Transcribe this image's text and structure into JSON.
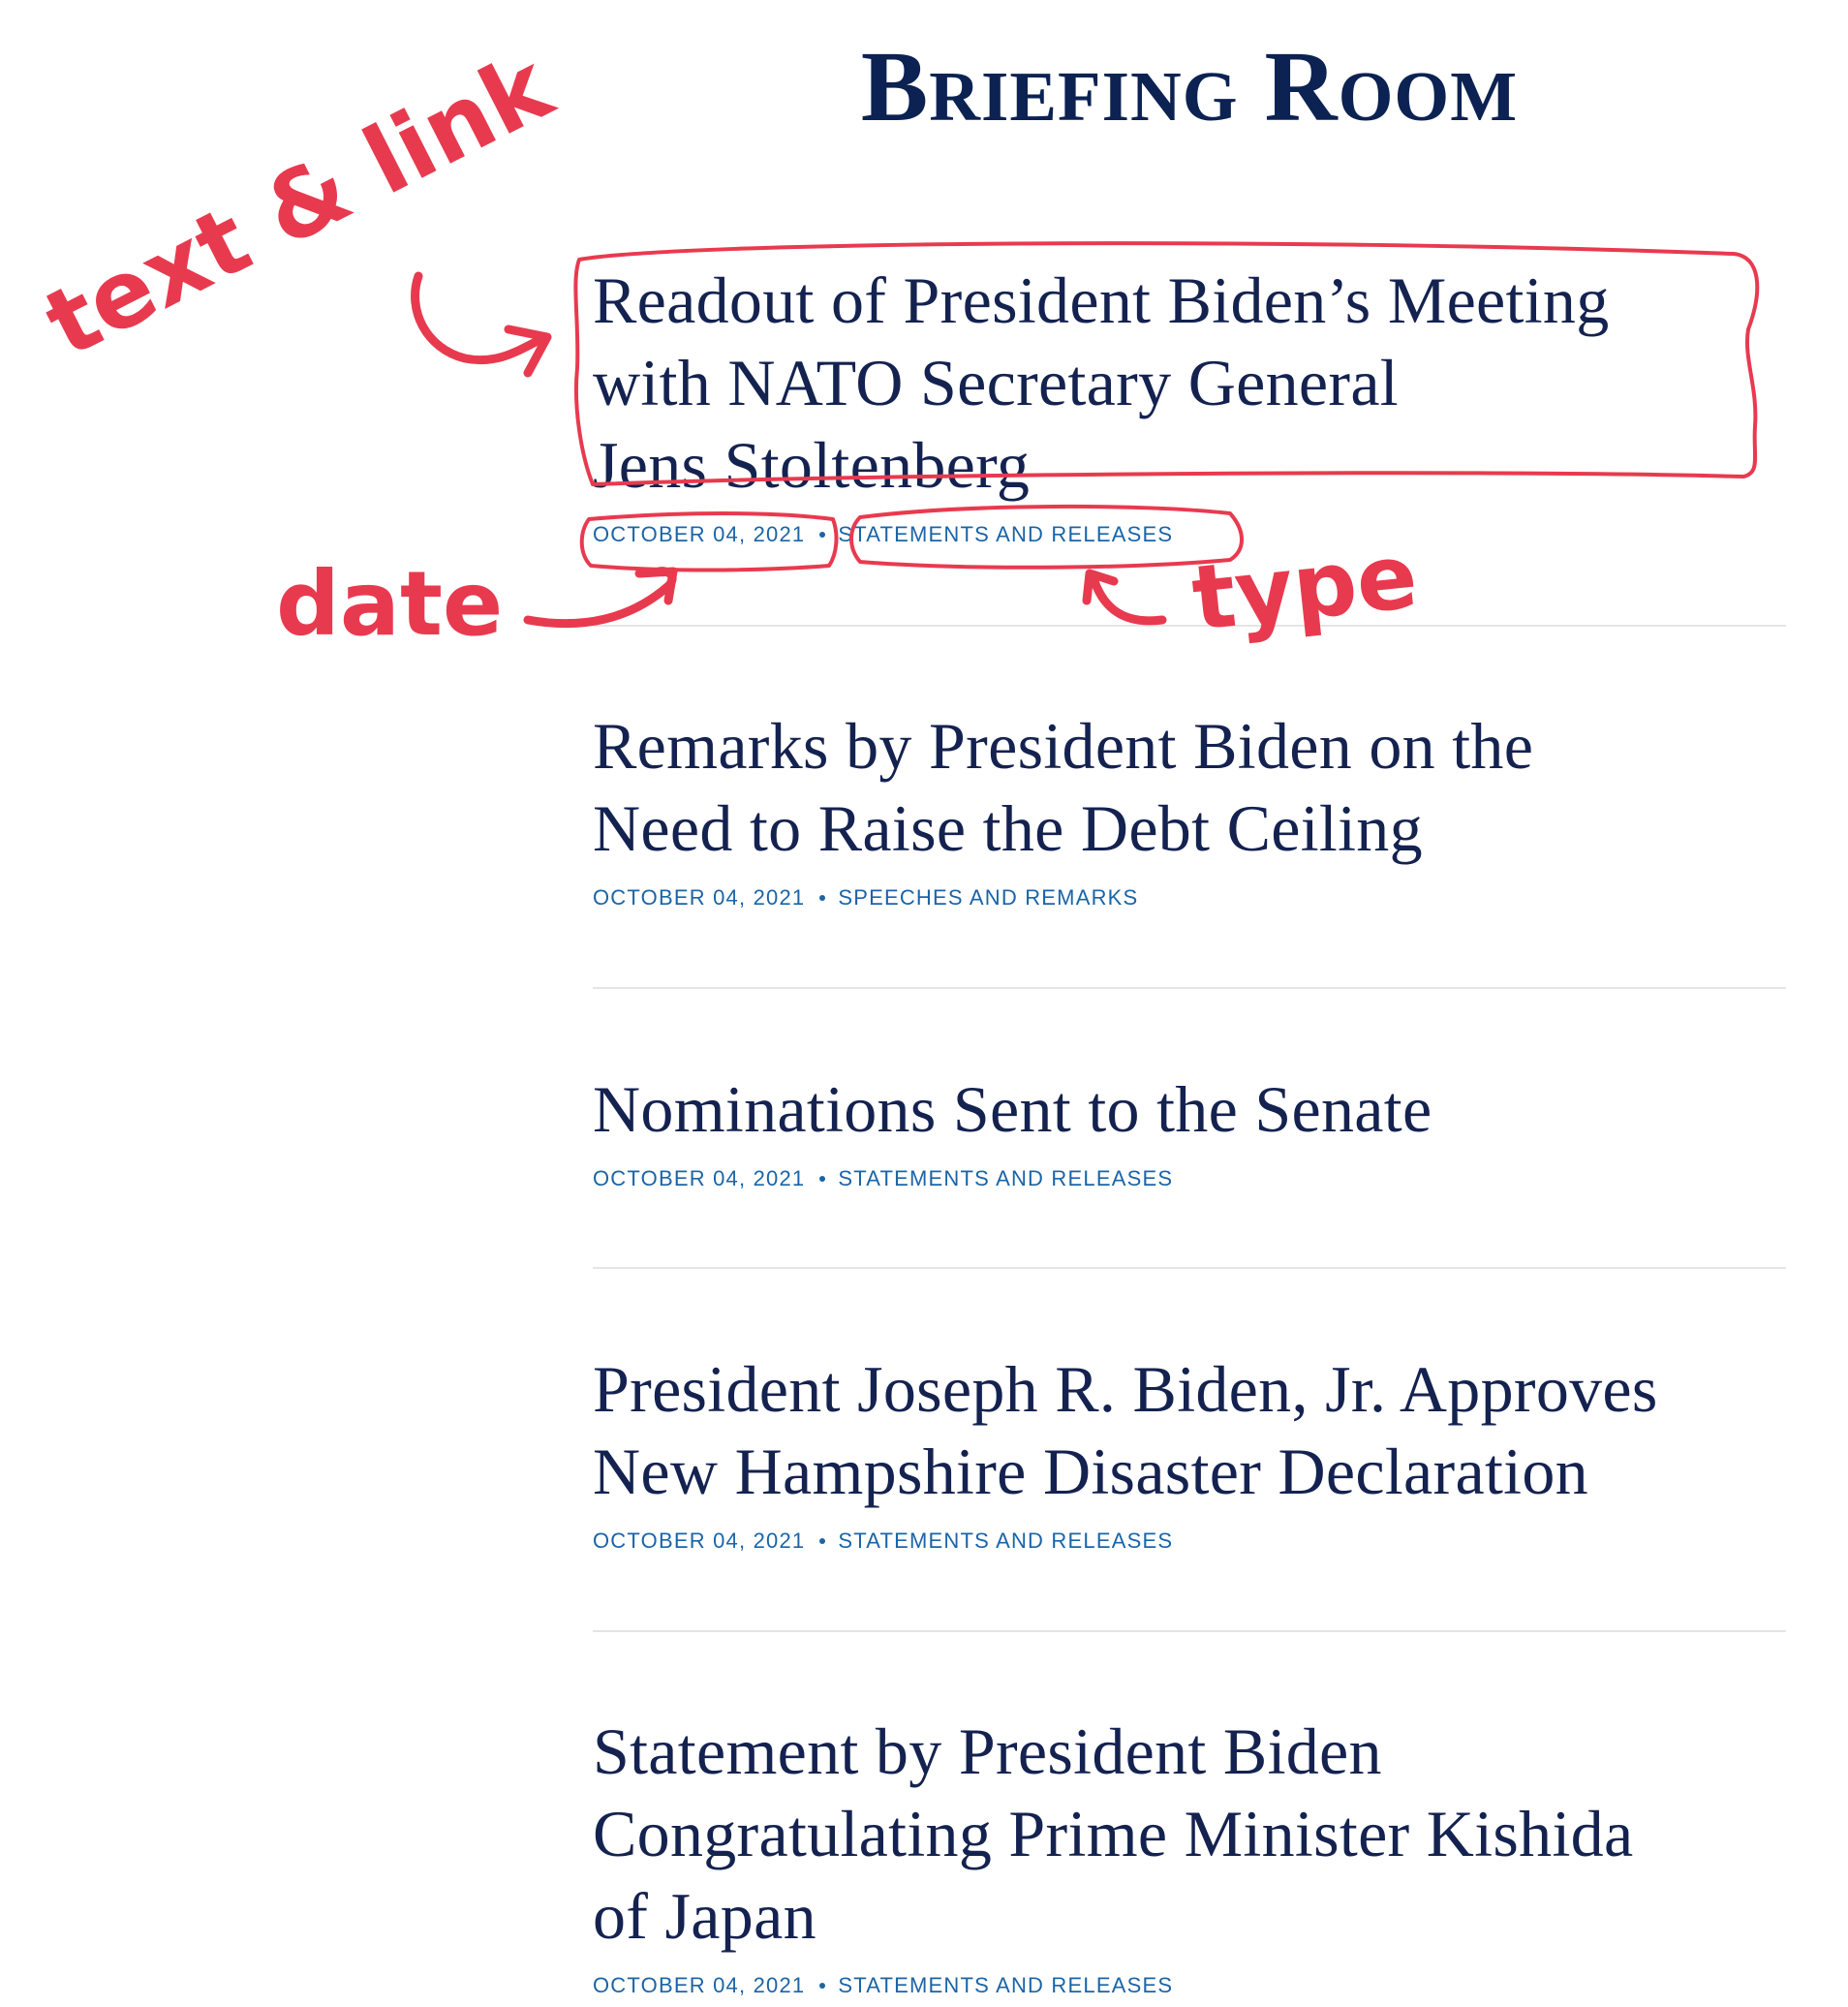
{
  "page": {
    "title": "Briefing Room"
  },
  "posts": [
    {
      "title_lines": [
        "Readout of President Biden’s Meeting",
        "with NATO Secretary General",
        "Jens Stoltenberg"
      ],
      "date": "OCTOBER 04, 2021",
      "type": "STATEMENTS AND RELEASES"
    },
    {
      "title_lines": [
        "Remarks by President Biden on the",
        "Need to Raise the Debt Ceiling"
      ],
      "date": "OCTOBER 04, 2021",
      "type": "SPEECHES AND REMARKS"
    },
    {
      "title_lines": [
        "Nominations Sent to the Senate"
      ],
      "date": "OCTOBER 04, 2021",
      "type": "STATEMENTS AND RELEASES"
    },
    {
      "title_lines": [
        "President Joseph R. Biden, Jr. Approves",
        "New Hampshire Disaster Declaration"
      ],
      "date": "OCTOBER 04, 2021",
      "type": "STATEMENTS AND RELEASES"
    },
    {
      "title_lines": [
        "Statement by President Biden",
        "Congratulating Prime Minister Kishida",
        "of Japan"
      ],
      "date": "OCTOBER 04, 2021",
      "type": "STATEMENTS AND RELEASES"
    }
  ],
  "annotations": {
    "text_link": "text & link",
    "date": "date",
    "type": "type",
    "color": "#e83a4f"
  }
}
